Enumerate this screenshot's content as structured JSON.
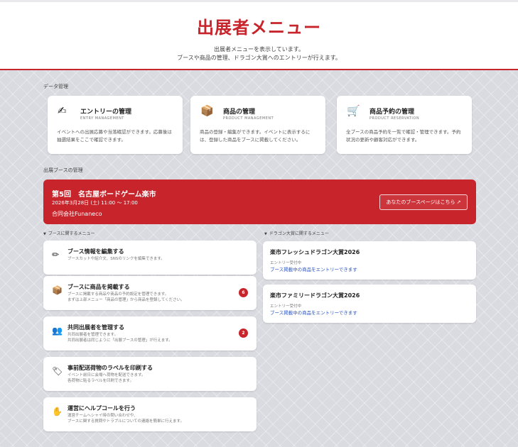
{
  "header": {
    "title": "出展者メニュー",
    "sub1": "出展者メニューを表示しています。",
    "sub2": "ブースや商品の管理、ドラゴン大賞へのエントリーが行えます。"
  },
  "data_section": {
    "label": "データ管理",
    "cards": [
      {
        "icon": "hand-writing-icon",
        "glyph": "✍",
        "title": "エントリーの管理",
        "en": "ENTRY MANAGEMENT",
        "desc": "イベントへの出展応募や当落確認ができます。応募後は抽選結果をここで確認できます。"
      },
      {
        "icon": "box-icon",
        "glyph": "📦",
        "title": "商品の管理",
        "en": "PRODUCT MANAGEMENT",
        "desc": "商品の登録・編集ができます。イベントに表示するには、登録した商品をブースに掲載してください。"
      },
      {
        "icon": "cart-icon",
        "glyph": "🛒",
        "title": "商品予約の管理",
        "en": "PRODUCT RESERVATION",
        "desc": "全ブースの商品予約を一覧で確認・管理できます。予約状況の更新や顧客対応ができます。"
      }
    ]
  },
  "booth_section": {
    "label": "出展ブースの管理",
    "title": "第5回　名古屋ボードゲーム楽市",
    "date": "2026年3月28日 (土) 11:00 ～ 17:00",
    "org": "合同会社Funaneco",
    "button": "あなたのブースページはこちら ↗"
  },
  "booth_menu": {
    "label": "ブースに関するメニュー",
    "items": [
      {
        "glyph": "✏",
        "title": "ブース情報を編集する",
        "desc1": "ブースカットや紹介文、SNSのリンクを編集できます。",
        "desc2": "",
        "badge": ""
      },
      {
        "glyph": "📦",
        "title": "ブースに商品を掲載する",
        "desc1": "ブースに掲載する商品や商品の予約設定を管理できます。",
        "desc2": "まずは上部メニュー「商品の管理」から商品を登録してください。",
        "badge": "6"
      },
      {
        "glyph": "👥",
        "title": "共同出展者を管理する",
        "desc1": "共同出展者を管理できます。",
        "desc2": "共同出展者は同じように「出展ブースの管理」が行えます。",
        "badge": "2"
      },
      {
        "glyph": "🏷",
        "title": "事前配送荷物のラベルを印刷する",
        "desc1": "イベント前日に会場へ荷物を配送できます。",
        "desc2": "各荷物に貼るラベルを印刷できます。",
        "badge": ""
      },
      {
        "glyph": "✋",
        "title": "運営にヘルプコールを行う",
        "desc1": "運営チームへシャイ時の問い合わせや、",
        "desc2": "ブースに関する質問やトラブルについての連絡を簡単に行えます。",
        "badge": ""
      }
    ]
  },
  "dragon_menu": {
    "label": "ドラゴン大賞に関するメニュー",
    "items": [
      {
        "title": "楽市フレッシュドラゴン大賞2026",
        "status": "エントリー受付中",
        "link": "ブース掲載中の商品をエントリーできます"
      },
      {
        "title": "楽市ファミリードラゴン大賞2026",
        "status": "エントリー受付中",
        "link": "ブース掲載中の商品をエントリーできます"
      }
    ]
  },
  "colors": {
    "accent": "#c7242b",
    "link": "#2a55c4"
  }
}
